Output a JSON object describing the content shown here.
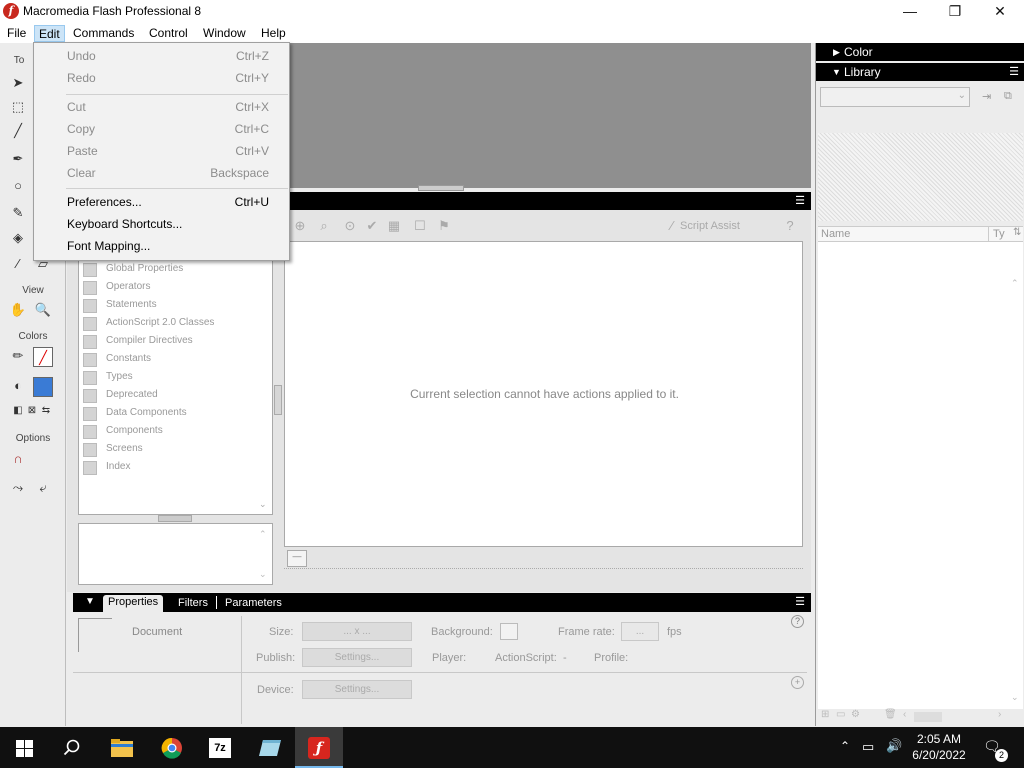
{
  "window": {
    "title": "Macromedia Flash Professional 8",
    "app_icon_letter": "f",
    "minimize": "—",
    "restore": "❐",
    "close": "✕"
  },
  "menubar": [
    {
      "label": "File"
    },
    {
      "label": "Edit"
    },
    {
      "label": "Commands"
    },
    {
      "label": "Control"
    },
    {
      "label": "Window"
    },
    {
      "label": "Help"
    }
  ],
  "edit_menu": {
    "items": [
      {
        "label": "Undo",
        "shortcut": "Ctrl+Z",
        "enabled": false
      },
      {
        "label": "Redo",
        "shortcut": "Ctrl+Y",
        "enabled": false
      },
      {
        "label": "Cut",
        "shortcut": "Ctrl+X",
        "enabled": false
      },
      {
        "label": "Copy",
        "shortcut": "Ctrl+C",
        "enabled": false
      },
      {
        "label": "Paste",
        "shortcut": "Ctrl+V",
        "enabled": false
      },
      {
        "label": "Clear",
        "shortcut": "Backspace",
        "enabled": false
      },
      {
        "label": "Preferences...",
        "shortcut": "Ctrl+U",
        "enabled": true
      },
      {
        "label": "Keyboard Shortcuts...",
        "shortcut": "",
        "enabled": true
      },
      {
        "label": "Font Mapping...",
        "shortcut": "",
        "enabled": true
      }
    ]
  },
  "tools": {
    "header": "To",
    "view_label": "View",
    "colors_label": "Colors",
    "options_label": "Options"
  },
  "actions": {
    "toolbox_items": [
      "Global Properties",
      "Operators",
      "Statements",
      "ActionScript 2.0 Classes",
      "Compiler Directives",
      "Constants",
      "Types",
      "Deprecated",
      "Data Components",
      "Components",
      "Screens",
      "Index"
    ],
    "script_assist": "Script Assist",
    "message": "Current selection cannot have actions applied to it."
  },
  "properties": {
    "tabs": [
      "Properties",
      "Filters",
      "Parameters"
    ],
    "document_label": "Document",
    "size_label": "Size:",
    "size_value": "... x ...",
    "background_label": "Background:",
    "frame_rate_label": "Frame rate:",
    "frame_rate_value": "...",
    "fps_label": "fps",
    "publish_label": "Publish:",
    "settings_label": "Settings...",
    "player_label": "Player:",
    "actionscript_label": "ActionScript:",
    "actionscript_value": "-",
    "profile_label": "Profile:",
    "device_label": "Device:",
    "device_settings_label": "Settings..."
  },
  "right_panels": {
    "color_title": "Color",
    "library_title": "Library",
    "name_col": "Name",
    "type_col": "Ty"
  },
  "taskbar": {
    "time": "2:05 AM",
    "date": "6/20/2022",
    "notification_count": "2",
    "apps": [
      {
        "name": "file-explorer"
      },
      {
        "name": "chrome"
      },
      {
        "name": "7zip",
        "label": "7z"
      },
      {
        "name": "notepad"
      },
      {
        "name": "flash"
      }
    ]
  }
}
